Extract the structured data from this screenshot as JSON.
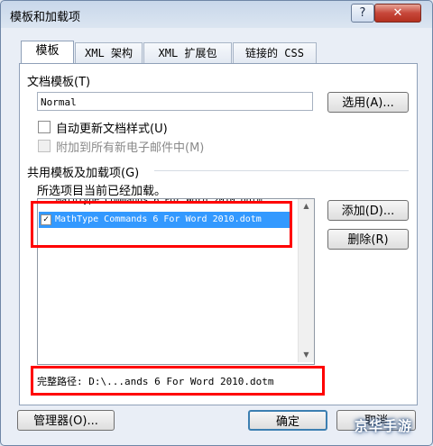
{
  "window": {
    "title": "模板和加载项",
    "help_label": "?",
    "close_label": "✕"
  },
  "tabs": [
    {
      "label": "模板"
    },
    {
      "label": "XML 架构"
    },
    {
      "label": "XML 扩展包"
    },
    {
      "label": "链接的 CSS"
    }
  ],
  "document_template": {
    "label": "文档模板(T)",
    "value": "Normal",
    "select_button": "选用(A)...",
    "auto_update_label": "自动更新文档样式(U)",
    "attach_all_label": "附加到所有新电子邮件中(M)"
  },
  "global_templates": {
    "label": "共用模板及加载项(G)",
    "note": "所选项目当前已经加载。",
    "items": [
      {
        "text": "MathType Commands 6 For Word 2010.dotm",
        "checked": true,
        "partial": "MathType Commands 6 For Word 2010.dotm"
      },
      {
        "text": "MathType Commands 6 For Word 2010.dotm",
        "checked": true
      }
    ],
    "add_button": "添加(D)...",
    "remove_button": "删除(R)",
    "full_path": "完整路径:  D:\\...ands 6 For Word 2010.dotm"
  },
  "footer": {
    "organizer_button": "管理器(O)...",
    "ok_button": "确定",
    "cancel_button": "取消"
  },
  "watermark": "京华手游",
  "colors": {
    "highlight": "#3399ff",
    "annotation_red": "#ff0000"
  }
}
